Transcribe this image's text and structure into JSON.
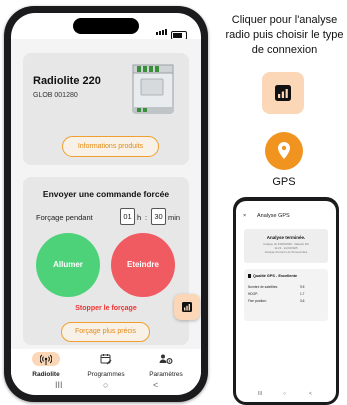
{
  "instruction": "Cliquer pour l'analyse radio puis choisir le type de connexion",
  "gps_label": "GPS",
  "colors": {
    "accent_orange": "#f0931f",
    "accent_peach": "#fbd6b7",
    "on_green": "#4dd27a",
    "off_red": "#f05a61"
  },
  "main_phone": {
    "device": {
      "name": "Radiolite 220",
      "id": "GLOB 001280",
      "info_button": "Informations produits"
    },
    "command": {
      "title": "Envoyer une commande forcée",
      "forcage_label": "Forçage pendant",
      "hours": "01",
      "hours_unit": "h",
      "separator": ":",
      "minutes": "30",
      "minutes_unit": "min",
      "on_button": "Allumer",
      "off_button": "Eteindre",
      "stop_link": "Stopper le forçage",
      "more_button": "Forçage plus précis"
    },
    "nav": [
      {
        "label": "Radiolite",
        "icon": "antenna-icon",
        "active": true
      },
      {
        "label": "Programmes",
        "icon": "calendar-edit-icon",
        "active": false
      },
      {
        "label": "Paramètres",
        "icon": "people-settings-icon",
        "active": false
      }
    ],
    "sysnav": {
      "recent": "III",
      "home": "○",
      "back": "<"
    }
  },
  "gps_phone": {
    "close": "×",
    "header": "Analyse GPS",
    "result_title": "Analyse terminée.",
    "result_details": [
      "Analyse du 23/06/2025 - Valentin Zitt",
      "11:23 - 11/23/2025",
      "Analyse d'environ de 50 secondes"
    ],
    "quality_title": "Qualité GPS - Excellente",
    "metrics": [
      {
        "label": "Nombre de satellites:",
        "value": "9.5"
      },
      {
        "label": "HDOP:",
        "value": "1.7"
      },
      {
        "label": "Fixe position:",
        "value": "3.6"
      }
    ],
    "sysnav": {
      "recent": "III",
      "home": "○",
      "back": "<"
    }
  }
}
